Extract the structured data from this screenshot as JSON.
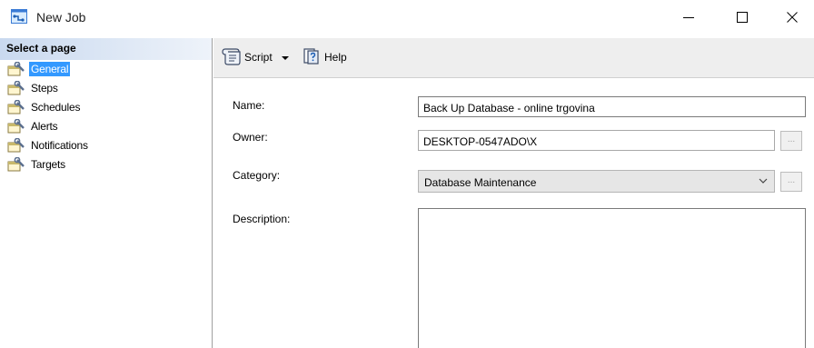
{
  "window": {
    "title": "New Job",
    "minimize_icon": "minimize-icon",
    "maximize_icon": "maximize-icon",
    "close_icon": "close-icon"
  },
  "sidebar": {
    "header": "Select a page",
    "items": [
      {
        "label": "General",
        "selected": true,
        "icon": "wrench-page-icon"
      },
      {
        "label": "Steps",
        "selected": false,
        "icon": "wrench-page-icon"
      },
      {
        "label": "Schedules",
        "selected": false,
        "icon": "wrench-page-icon"
      },
      {
        "label": "Alerts",
        "selected": false,
        "icon": "wrench-page-icon"
      },
      {
        "label": "Notifications",
        "selected": false,
        "icon": "wrench-page-icon"
      },
      {
        "label": "Targets",
        "selected": false,
        "icon": "wrench-page-icon"
      }
    ]
  },
  "toolbar": {
    "script_label": "Script",
    "help_label": "Help"
  },
  "form": {
    "name_label": "Name:",
    "name_value": "Back Up Database - online trgovina",
    "owner_label": "Owner:",
    "owner_value": "DESKTOP-0547ADO\\X",
    "owner_browse": "...",
    "category_label": "Category:",
    "category_value": "Database Maintenance",
    "category_browse": "...",
    "description_label": "Description:",
    "description_value": ""
  },
  "colors": {
    "selection": "#3399ff",
    "header_gradient_start": "#c9d9ef",
    "toolbar_bg": "#eeeeee"
  }
}
